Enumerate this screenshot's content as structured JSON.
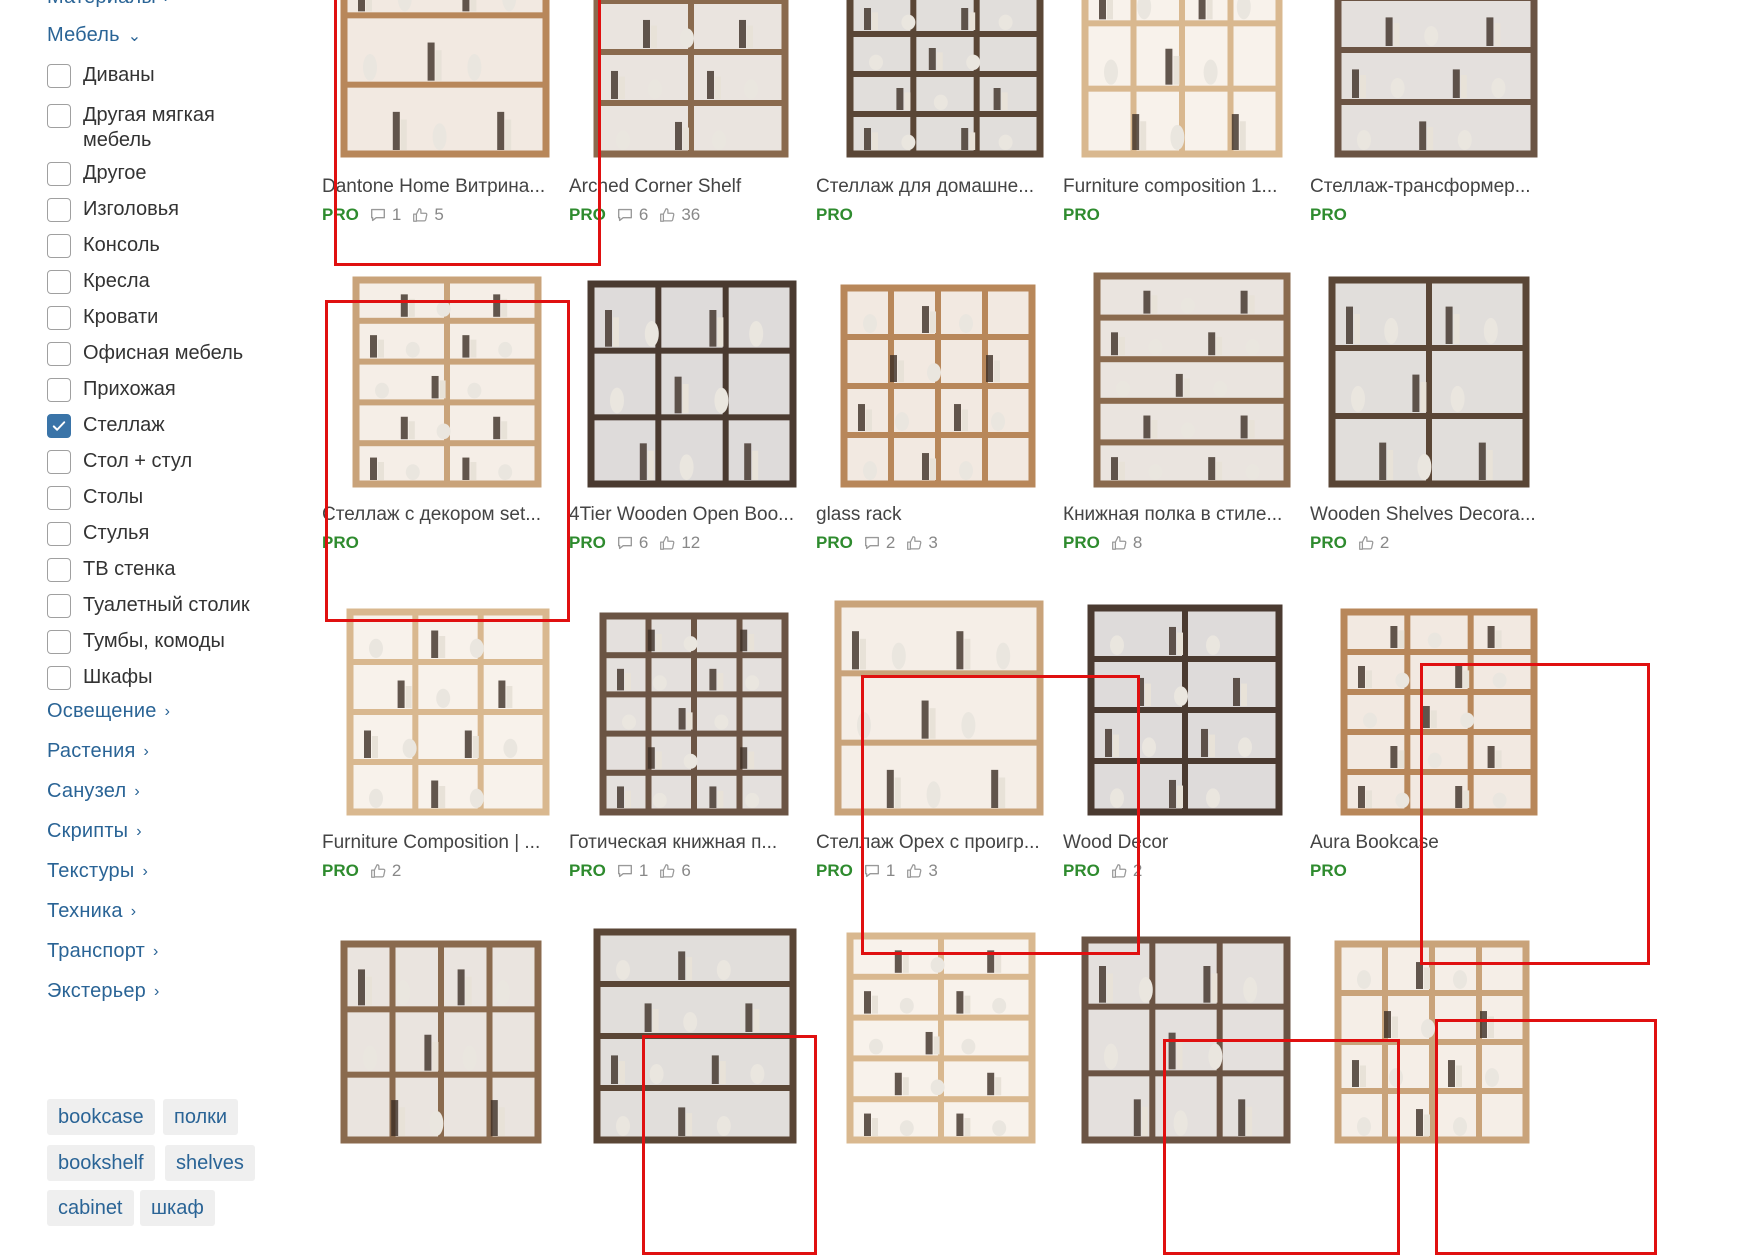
{
  "sidebar": {
    "materials_label": "Материалы",
    "furniture_label": "Мебель",
    "furniture_items": [
      {
        "label": "Диваны",
        "checked": false
      },
      {
        "label": "Другая мягкая мебель",
        "checked": false
      },
      {
        "label": "Другое",
        "checked": false
      },
      {
        "label": "Изголовья",
        "checked": false
      },
      {
        "label": "Консоль",
        "checked": false
      },
      {
        "label": "Кресла",
        "checked": false
      },
      {
        "label": "Кровати",
        "checked": false
      },
      {
        "label": "Офисная мебель",
        "checked": false
      },
      {
        "label": "Прихожая",
        "checked": false
      },
      {
        "label": "Стеллаж",
        "checked": true
      },
      {
        "label": "Стол + стул",
        "checked": false
      },
      {
        "label": "Столы",
        "checked": false
      },
      {
        "label": "Стулья",
        "checked": false
      },
      {
        "label": "ТВ стенка",
        "checked": false
      },
      {
        "label": "Туалетный столик",
        "checked": false
      },
      {
        "label": "Тумбы, комоды",
        "checked": false
      },
      {
        "label": "Шкафы",
        "checked": false
      }
    ],
    "categories": [
      "Освещение",
      "Растения",
      "Санузел",
      "Скрипты",
      "Текстуры",
      "Техника",
      "Транспорт",
      "Экстерьер"
    ],
    "tags": [
      "bookcase",
      "полки",
      "bookshelf",
      "shelves",
      "cabinet",
      "шкаф"
    ]
  },
  "pro_label": "PRO",
  "cards": [
    {
      "title": "Dantone Home Витрина...",
      "comments": "1",
      "likes": "5"
    },
    {
      "title": "Arched Corner Shelf",
      "comments": "6",
      "likes": "36"
    },
    {
      "title": "Стеллаж для домашне...",
      "comments": "",
      "likes": ""
    },
    {
      "title": "Furniture composition 1...",
      "comments": "",
      "likes": ""
    },
    {
      "title": "Стеллаж-трансформер...",
      "comments": "",
      "likes": ""
    },
    {
      "title": "Стеллаж с декором set...",
      "comments": "",
      "likes": ""
    },
    {
      "title": "4Tier Wooden Open Boo...",
      "comments": "6",
      "likes": "12"
    },
    {
      "title": "glass rack",
      "comments": "2",
      "likes": "3"
    },
    {
      "title": "Книжная полка в стиле...",
      "comments": "",
      "likes": "8"
    },
    {
      "title": "Wooden Shelves Decora...",
      "comments": "",
      "likes": "2"
    },
    {
      "title": "Furniture Composition | ...",
      "comments": "",
      "likes": "2"
    },
    {
      "title": "Готическая книжная п...",
      "comments": "1",
      "likes": "6"
    },
    {
      "title": "Стеллаж Opex с проигр...",
      "comments": "1",
      "likes": "3"
    },
    {
      "title": "Wood Decor",
      "comments": "",
      "likes": "2"
    },
    {
      "title": "Aura Bookcase",
      "comments": "",
      "likes": ""
    },
    {
      "title": "",
      "comments": "",
      "likes": ""
    },
    {
      "title": "",
      "comments": "",
      "likes": ""
    },
    {
      "title": "",
      "comments": "",
      "likes": ""
    },
    {
      "title": "",
      "comments": "",
      "likes": ""
    },
    {
      "title": "",
      "comments": "",
      "likes": ""
    }
  ],
  "colors": {
    "link": "#2a6496",
    "pro": "#2e8b2e",
    "highlight": "#e01010",
    "checkbox_checked": "#3a74a8"
  }
}
